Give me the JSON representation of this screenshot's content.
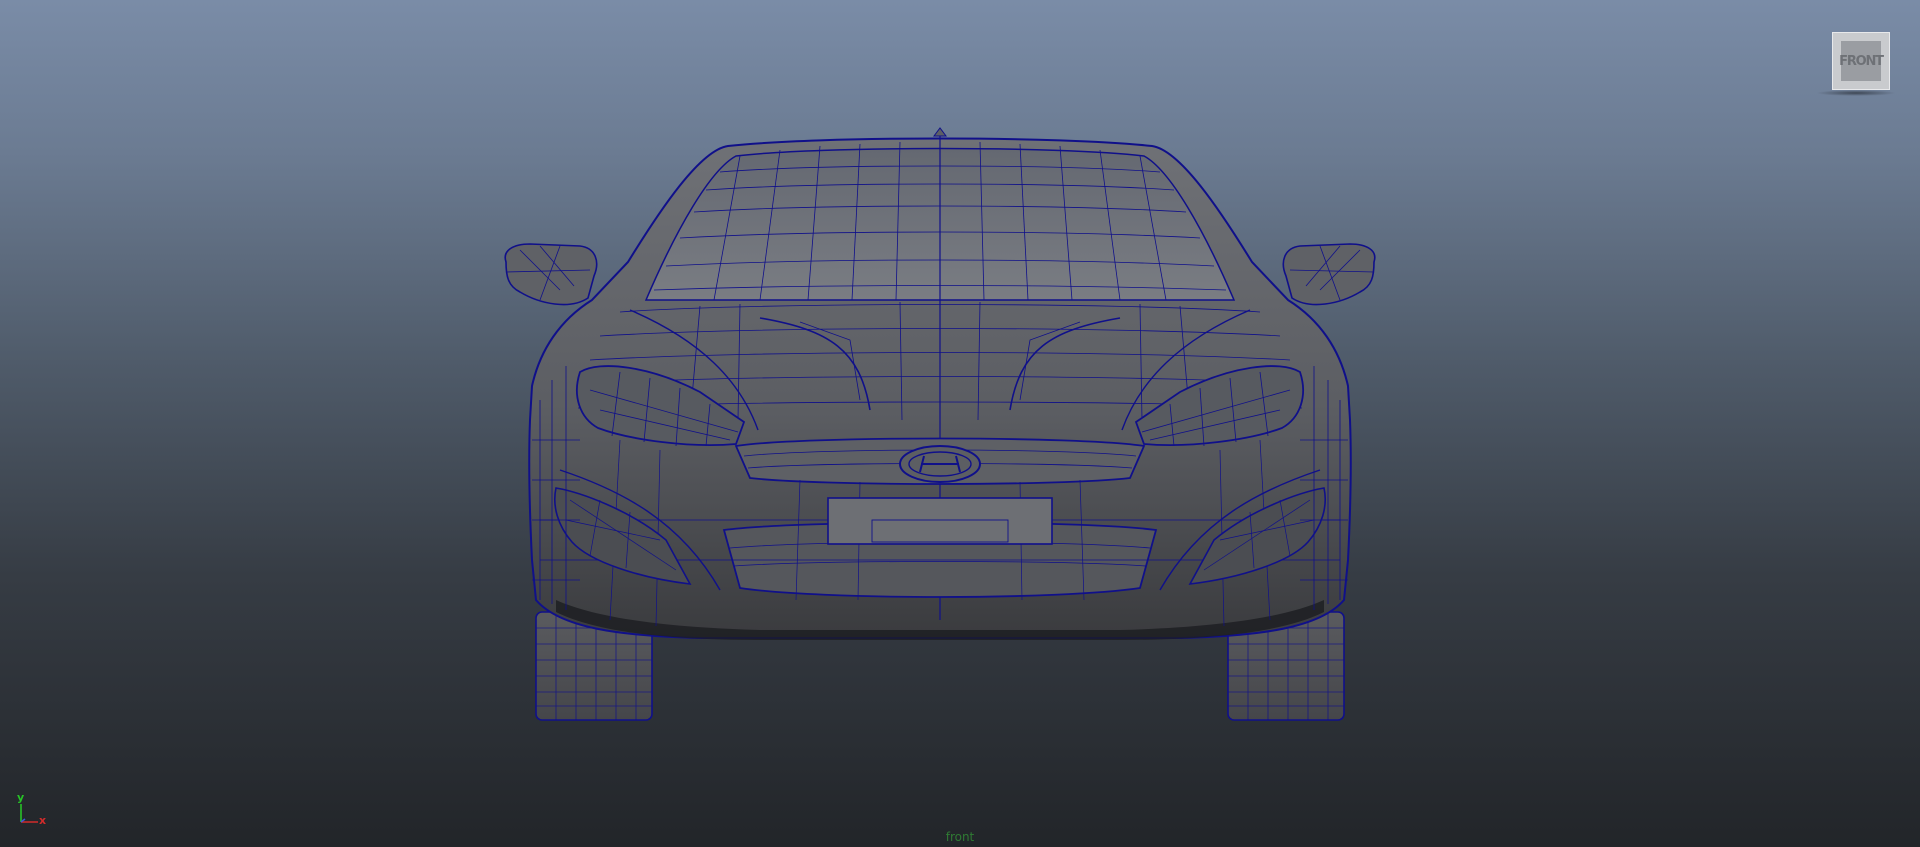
{
  "viewport": {
    "camera_name": "front",
    "background_colors": [
      "#7a8ca7",
      "#505c6b",
      "#222529"
    ]
  },
  "view_cube": {
    "label": "FRONT"
  },
  "axis_gizmo": {
    "y_label": "y",
    "x_label": "x",
    "y_color": "#27c227",
    "x_color": "#d22b2b",
    "z_color": "#3d5ad8"
  },
  "model": {
    "wire_color": "#10108a",
    "shade_color": "#585a5f",
    "icon": "car-wireframe"
  }
}
